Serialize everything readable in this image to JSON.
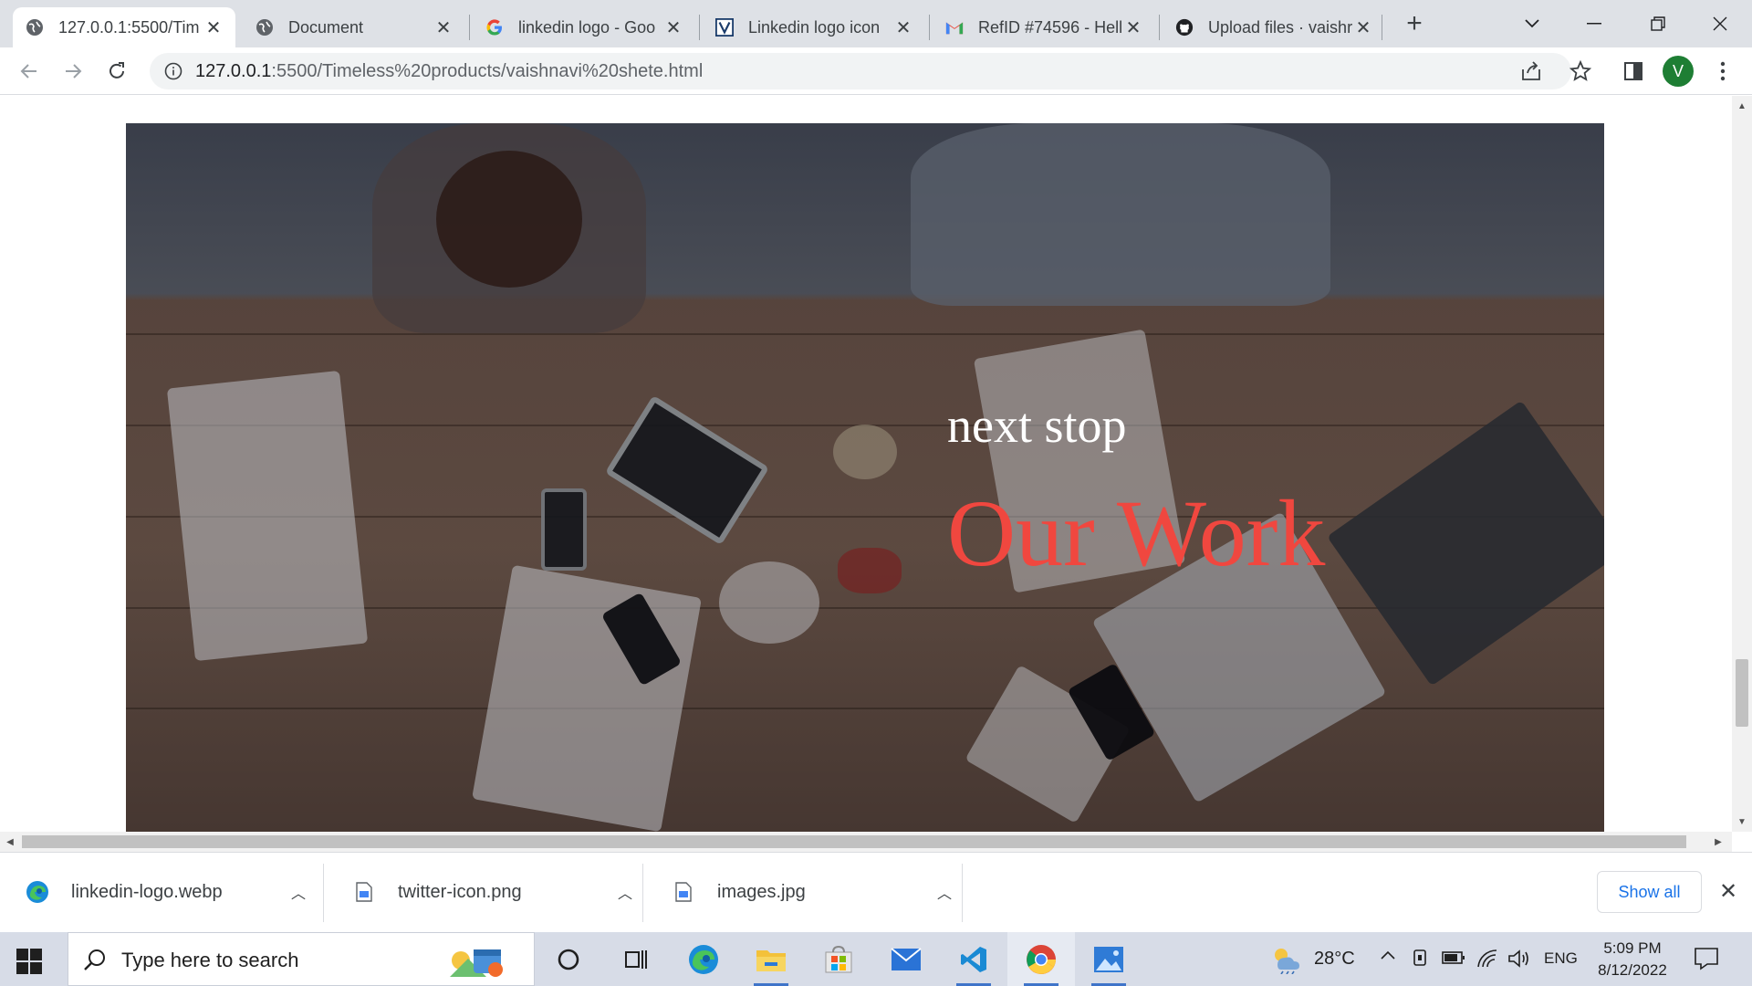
{
  "browser": {
    "tabs": [
      {
        "title": "127.0.0.1:5500/Tim",
        "favicon": "globe-icon",
        "active": true
      },
      {
        "title": "Document",
        "favicon": "globe-icon",
        "active": false
      },
      {
        "title": "linkedin logo - Goo",
        "favicon": "google-g-icon",
        "active": false
      },
      {
        "title": "Linkedin logo icon",
        "favicon": "vector-site-icon",
        "active": false
      },
      {
        "title": "RefID #74596 - Hell",
        "favicon": "gmail-icon",
        "active": false
      },
      {
        "title": "Upload files · vaishr",
        "favicon": "github-icon",
        "active": false
      }
    ],
    "new_tab_glyph": "+",
    "url_host": "127.0.0.1",
    "url_rest": ":5500/Timeless%20products/vaishnavi%20shete.html",
    "profile_initial": "V",
    "accent": "#1e7e34"
  },
  "page": {
    "hero": {
      "subtitle": "next stop",
      "title": "Our Work",
      "title_color": "#f0473f"
    }
  },
  "downloads": {
    "items": [
      {
        "name": "linkedin-logo.webp",
        "icon": "edge-file-icon"
      },
      {
        "name": "twitter-icon.png",
        "icon": "image-file-icon"
      },
      {
        "name": "images.jpg",
        "icon": "image-file-icon"
      }
    ],
    "show_all": "Show all"
  },
  "taskbar": {
    "search_placeholder": "Type here to search",
    "weather": "28°C",
    "language": "ENG",
    "time": "5:09 PM",
    "date": "8/12/2022"
  }
}
